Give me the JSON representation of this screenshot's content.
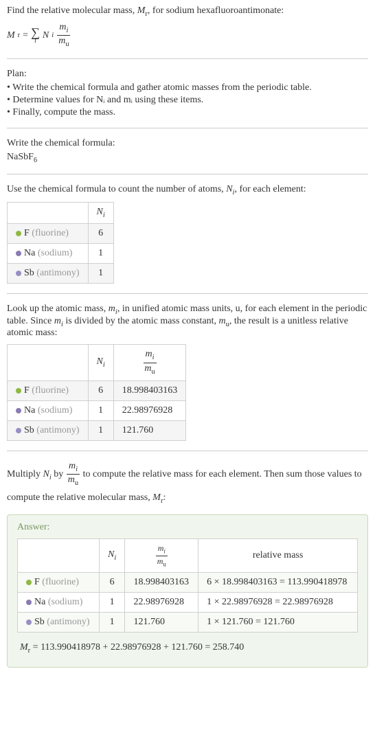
{
  "intro": {
    "line1": "Find the relative molecular mass, ",
    "mr": "M",
    "mr_sub": "r",
    "line1_end": ", for sodium hexafluoroantimonate:",
    "eq_left": "M",
    "eq_left_sub": "r",
    "eq_eq": " = ",
    "sigma_sub": "i",
    "n": "N",
    "n_sub": "i",
    "frac_num_m": "m",
    "frac_num_sub": "i",
    "frac_den_m": "m",
    "frac_den_sub": "u"
  },
  "plan": {
    "title": "Plan:",
    "items": [
      "• Write the chemical formula and gather atomic masses from the periodic table.",
      "• Determine values for Nᵢ and mᵢ using these items.",
      "• Finally, compute the mass."
    ]
  },
  "chem": {
    "title": "Write the chemical formula:",
    "formula_prefix": "NaSbF",
    "formula_sub": "6"
  },
  "count": {
    "title_a": "Use the chemical formula to count the number of atoms, ",
    "ni": "N",
    "ni_sub": "i",
    "title_b": ", for each element:",
    "header_ni": "N",
    "header_ni_sub": "i",
    "rows": [
      {
        "color": "#8fb843",
        "sym": "F",
        "name": "(fluorine)",
        "n": "6"
      },
      {
        "color": "#8a7bb3",
        "sym": "Na",
        "name": "(sodium)",
        "n": "1"
      },
      {
        "color": "#9a8fc4",
        "sym": "Sb",
        "name": "(antimony)",
        "n": "1"
      }
    ]
  },
  "lookup": {
    "text_a": "Look up the atomic mass, ",
    "mi": "m",
    "mi_sub": "i",
    "text_b": ", in unified atomic mass units, u, for each element in the periodic table. Since ",
    "text_c": " is divided by the atomic mass constant, ",
    "mu": "m",
    "mu_sub": "u",
    "text_d": ", the result is a unitless relative atomic mass:",
    "header_ni": "N",
    "header_ni_sub": "i",
    "rows": [
      {
        "color": "#8fb843",
        "sym": "F",
        "name": "(fluorine)",
        "n": "6",
        "mass": "18.998403163"
      },
      {
        "color": "#8a7bb3",
        "sym": "Na",
        "name": "(sodium)",
        "n": "1",
        "mass": "22.98976928"
      },
      {
        "color": "#9a8fc4",
        "sym": "Sb",
        "name": "(antimony)",
        "n": "1",
        "mass": "121.760"
      }
    ]
  },
  "multiply": {
    "text_a": "Multiply ",
    "ni": "N",
    "ni_sub": "i",
    "text_b": " by ",
    "text_c": " to compute the relative mass for each element. Then sum those values to compute the relative molecular mass, ",
    "mr": "M",
    "mr_sub": "r",
    "text_d": ":"
  },
  "answer": {
    "title": "Answer:",
    "header_relmass": "relative mass",
    "rows": [
      {
        "color": "#8fb843",
        "sym": "F",
        "name": "(fluorine)",
        "n": "6",
        "mass": "18.998403163",
        "rel": "6 × 18.998403163 = 113.990418978"
      },
      {
        "color": "#8a7bb3",
        "sym": "Na",
        "name": "(sodium)",
        "n": "1",
        "mass": "22.98976928",
        "rel": "1 × 22.98976928 = 22.98976928"
      },
      {
        "color": "#9a8fc4",
        "sym": "Sb",
        "name": "(antimony)",
        "n": "1",
        "mass": "121.760",
        "rel": "1 × 121.760 = 121.760"
      }
    ],
    "final_mr": "M",
    "final_mr_sub": "r",
    "final_eq": " = 113.990418978 + 22.98976928 + 121.760 = 258.740"
  }
}
